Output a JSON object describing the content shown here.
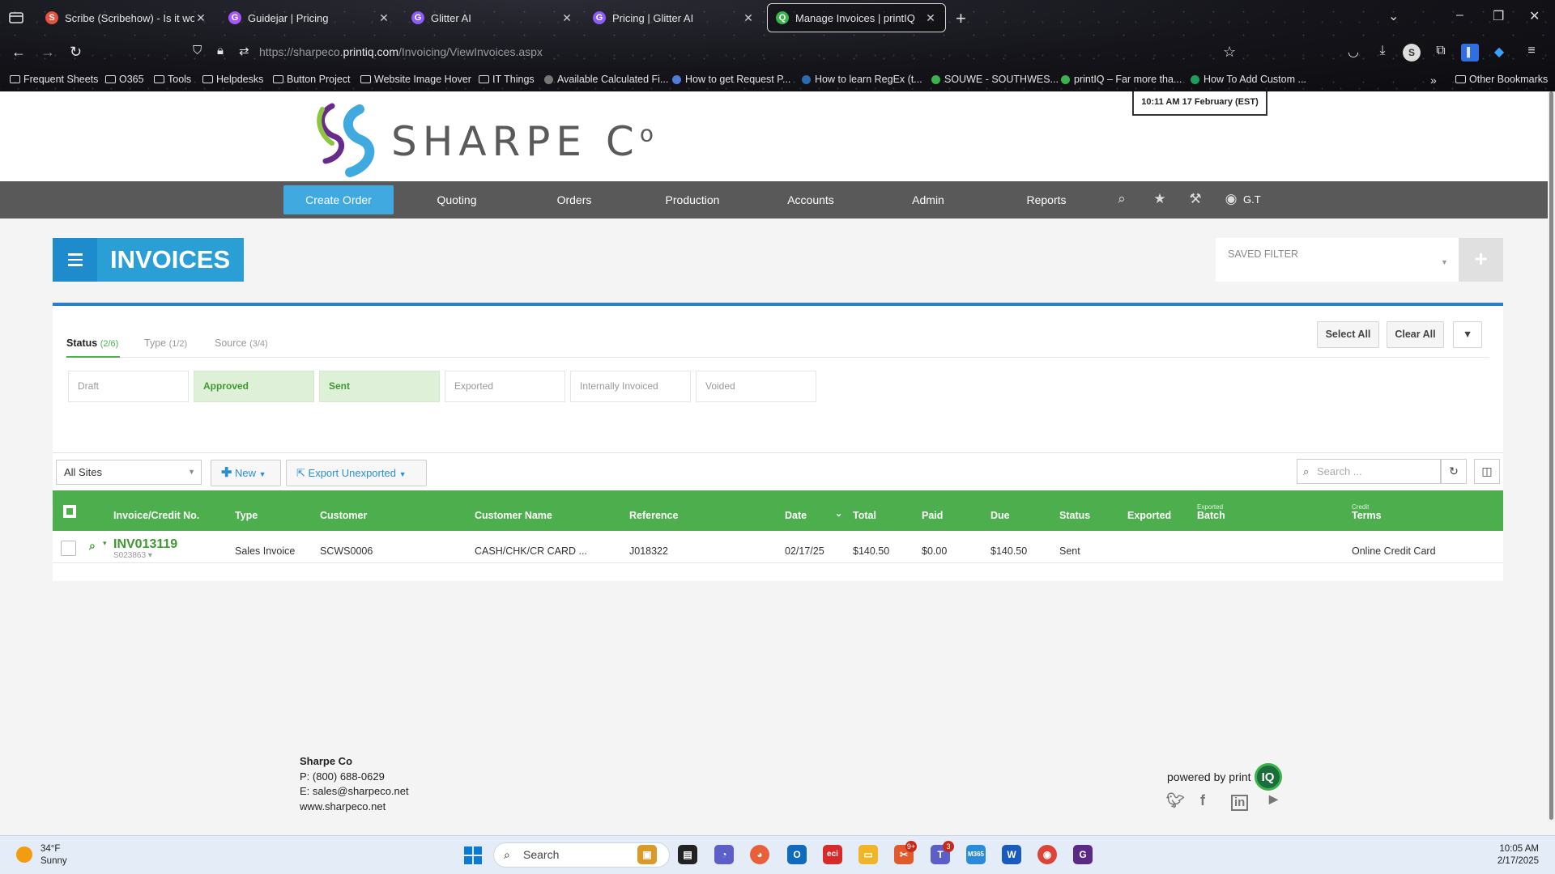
{
  "browser": {
    "tabs": [
      {
        "label": "Scribe (Scribehow) - Is it worth",
        "color": "#e8513a",
        "glyph": "S"
      },
      {
        "label": "Guidejar | Pricing",
        "color": "#a855f7",
        "glyph": "G"
      },
      {
        "label": "Glitter AI",
        "color": "#8b5cf6",
        "glyph": "G"
      },
      {
        "label": "Pricing | Glitter AI",
        "color": "#8b5cf6",
        "glyph": "G"
      },
      {
        "label": "Manage Invoices | printIQ",
        "color": "#3ab34a",
        "glyph": "Q"
      }
    ],
    "url_prefix": "https://sharpeco.",
    "url_domain": "printiq.com",
    "url_path": "/Invoicing/ViewInvoices.aspx",
    "bookmarks": [
      {
        "label": "Frequent Sheets",
        "kind": "folder"
      },
      {
        "label": "O365",
        "kind": "folder"
      },
      {
        "label": "Tools",
        "kind": "folder"
      },
      {
        "label": "Helpdesks",
        "kind": "folder"
      },
      {
        "label": "Button Project",
        "kind": "folder"
      },
      {
        "label": "Website Image Hover",
        "kind": "folder"
      },
      {
        "label": "IT Things",
        "kind": "folder"
      },
      {
        "label": "Available Calculated Fi...",
        "kind": "dot",
        "color": "#777777"
      },
      {
        "label": "How to get Request P...",
        "kind": "dot",
        "color": "#4f7bd9"
      },
      {
        "label": "How to learn RegEx (t...",
        "kind": "dot",
        "color": "#2b6cb0"
      },
      {
        "label": "SOUWE - SOUTHWES...",
        "kind": "dot",
        "color": "#3ab34a"
      },
      {
        "label": "printIQ – Far more tha...",
        "kind": "dot",
        "color": "#3ab34a"
      },
      {
        "label": "How To Add Custom ...",
        "kind": "dot",
        "color": "#1e9e5b"
      }
    ],
    "other_bookmarks": "Other Bookmarks"
  },
  "header": {
    "company": "SHARPE C",
    "company_suffix": "o",
    "clock": "10:11 AM  17 February (EST)"
  },
  "nav": {
    "create_order": "Create Order",
    "items": [
      "Quoting",
      "Orders",
      "Production",
      "Accounts",
      "Admin",
      "Reports"
    ],
    "user": "G.T"
  },
  "page": {
    "title": "INVOICES",
    "saved_filter_label": "SAVED FILTER"
  },
  "filters": {
    "tabs": [
      {
        "label": "Status",
        "count": "(2/6)"
      },
      {
        "label": "Type",
        "count": "(1/2)"
      },
      {
        "label": "Source",
        "count": "(3/4)"
      }
    ],
    "select_all": "Select All",
    "clear_all": "Clear All",
    "chips": [
      {
        "label": "Draft",
        "on": false
      },
      {
        "label": "Approved",
        "on": true
      },
      {
        "label": "Sent",
        "on": true
      },
      {
        "label": "Exported",
        "on": false
      },
      {
        "label": "Internally Invoiced",
        "on": false
      },
      {
        "label": "Voided",
        "on": false
      }
    ]
  },
  "toolbar": {
    "site": "All Sites",
    "new_label": "New",
    "export_label": "Export Unexported",
    "search_placeholder": "Search ..."
  },
  "table": {
    "columns": {
      "invoice_no": "Invoice/Credit No.",
      "type": "Type",
      "customer": "Customer",
      "customer_name": "Customer Name",
      "reference": "Reference",
      "date": "Date",
      "total": "Total",
      "paid": "Paid",
      "due": "Due",
      "status": "Status",
      "exported": "Exported",
      "batch_sup": "Exported",
      "batch": "Batch",
      "terms_sup": "Credit",
      "terms": "Terms"
    },
    "rows": [
      {
        "invoice_no": "INV013119",
        "sub": "S023863",
        "type": "Sales Invoice",
        "customer": "SCWS0006",
        "customer_name": "CASH/CHK/CR CARD ...",
        "reference": "J018322",
        "date": "02/17/25",
        "total": "$140.50",
        "paid": "$0.00",
        "due": "$140.50",
        "status": "Sent",
        "exported": "",
        "batch": "",
        "terms": "Online Credit Card"
      }
    ]
  },
  "footer": {
    "name": "Sharpe Co",
    "phone": "P: (800) 688-0629",
    "email": "E: sales@sharpeco.net",
    "web": "www.sharpeco.net",
    "powered": "powered by print",
    "powered_logo": "IQ"
  },
  "taskbar": {
    "temp": "34°F",
    "condition": "Sunny",
    "search": "Search",
    "time": "10:05 AM",
    "date": "2/17/2025",
    "teams_badge": "3",
    "app2_badge": "9+"
  }
}
